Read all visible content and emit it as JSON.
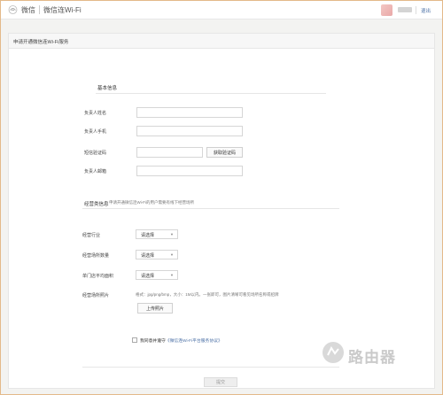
{
  "header": {
    "brand": "微信",
    "product": "微信连Wi-Fi",
    "logout": "退出"
  },
  "form": {
    "page_title": "申请开通微信连Wi-Fi服务",
    "basic_section": "基本信息",
    "fields": [
      {
        "label": "负责人姓名",
        "value": ""
      },
      {
        "label": "负责人手机",
        "value": ""
      },
      {
        "label": "短信验证码",
        "value": ""
      },
      {
        "label": "负责人邮箱",
        "value": ""
      }
    ],
    "get_code_button": "获取验证码",
    "business_section": "经营类信息",
    "business_hint": "申请开通微信连Wi-Fi的用户需要有线下经营场所",
    "selects": [
      {
        "label": "经营行业",
        "value": "请选择"
      },
      {
        "label": "经营场所数量",
        "value": "请选择"
      },
      {
        "label": "单门店平均面积",
        "value": "请选择"
      }
    ],
    "photo_label": "经营场所照片",
    "photo_hint": "格式：jpg/png/bmp，大小：1M以内。一张即可，图片清晰可看见场所名称或招牌",
    "upload_button": "上传照片",
    "agree_prefix": "我同意并遵守",
    "agree_link": "《微信连Wi-Fi平台服务协议》",
    "submit_button": "提交"
  },
  "watermark": "路由器"
}
